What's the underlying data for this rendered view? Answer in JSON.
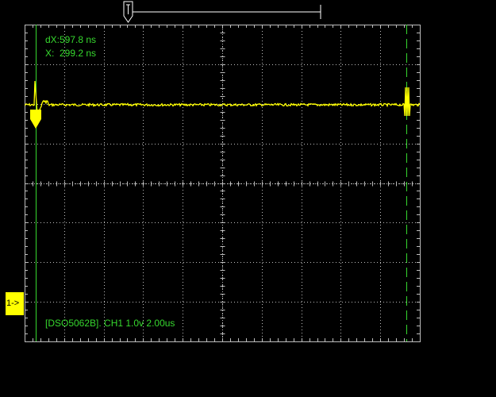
{
  "readouts": {
    "dx": "dX:597.8 ns",
    "x": "X:  299.2 ns"
  },
  "status_line": "[DSO5062B]. CH1 1.0v 2.00us",
  "channel_marker": "1->",
  "colors": {
    "background": "#000000",
    "grid": "#bdbdbd",
    "trace": "#ffff00",
    "cursor": "#36d82e",
    "text": "#36d82e",
    "trigger_indicator": "#ffffff"
  },
  "display": {
    "horizontal_divisions": 10,
    "vertical_divisions": 8,
    "minor_ticks_per_division": 5
  }
}
